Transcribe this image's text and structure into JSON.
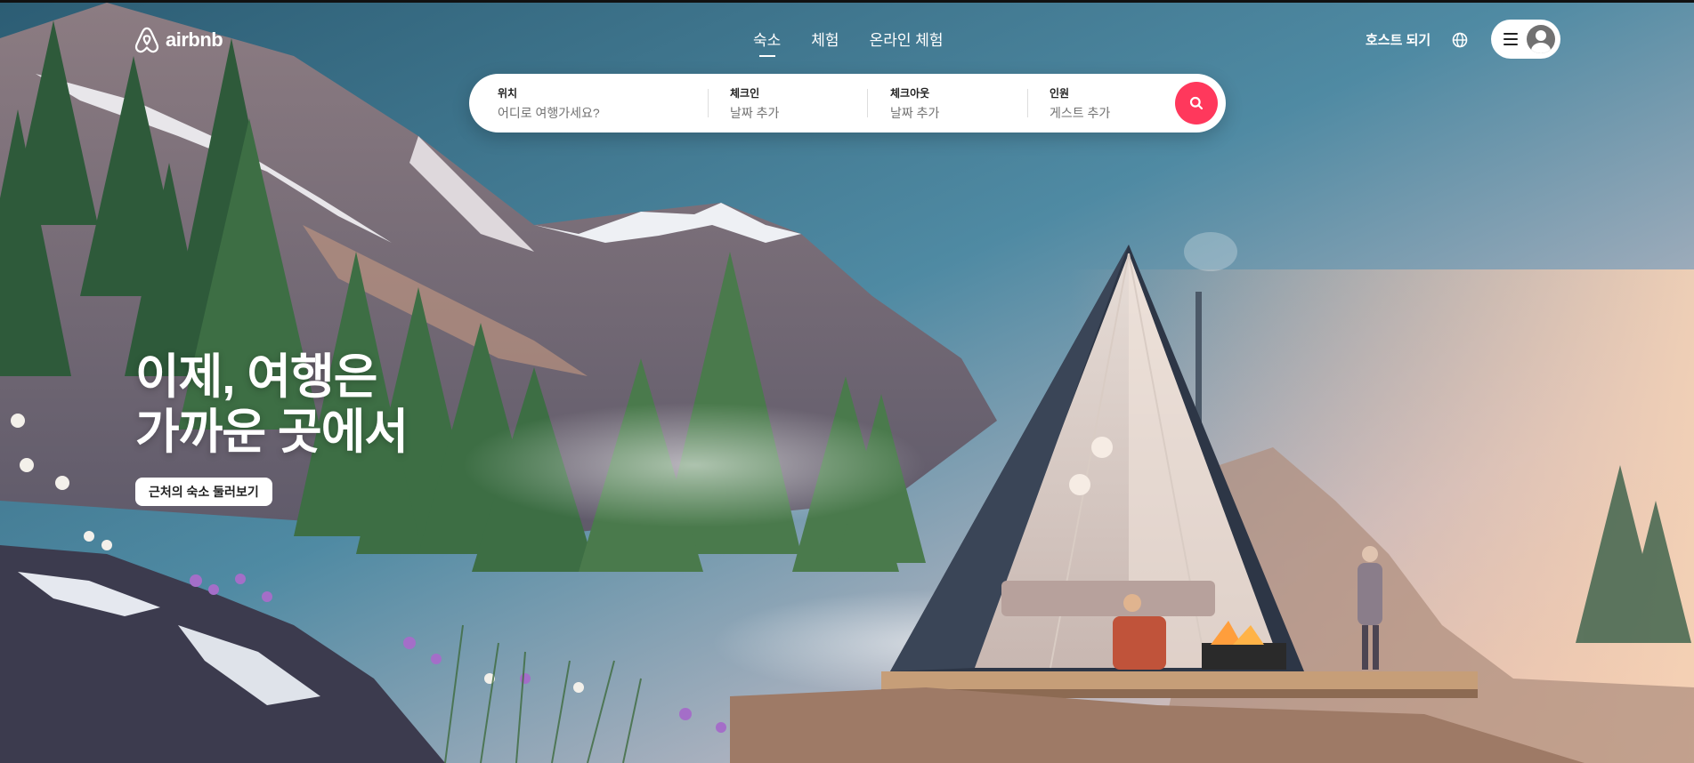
{
  "brand": {
    "logo_text": "airbnb",
    "accent_color": "#ff385c"
  },
  "nav": {
    "items": [
      {
        "label": "숙소",
        "active": true
      },
      {
        "label": "체험",
        "active": false
      },
      {
        "label": "온라인 체험",
        "active": false
      }
    ]
  },
  "header": {
    "host_label": "호스트 되기",
    "globe_icon": "globe-icon",
    "menu_icon": "hamburger-icon",
    "avatar_icon": "user-avatar-icon"
  },
  "search": {
    "location": {
      "label": "위치",
      "placeholder": "어디로 여행가세요?"
    },
    "checkin": {
      "label": "체크인",
      "placeholder": "날짜 추가"
    },
    "checkout": {
      "label": "체크아웃",
      "placeholder": "날짜 추가"
    },
    "guests": {
      "label": "인원",
      "placeholder": "게스트 추가"
    },
    "button_icon": "search-icon"
  },
  "hero": {
    "title_line1": "이제, 여행은",
    "title_line2": "가까운 곳에서",
    "cta_label": "근처의 숙소 둘러보기"
  }
}
